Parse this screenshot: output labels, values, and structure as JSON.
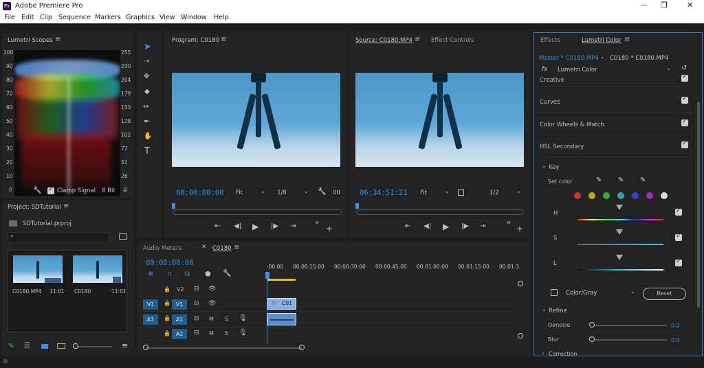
{
  "app": {
    "title": "Adobe Premiere Pro",
    "logo": "Pr"
  },
  "menu": [
    "File",
    "Edit",
    "Clip",
    "Sequence",
    "Markers",
    "Graphics",
    "View",
    "Window",
    "Help"
  ],
  "window_controls": {
    "minimize": "—",
    "maximize": "❐",
    "close": "✕"
  },
  "scopes": {
    "title": "Lumetri Scopes",
    "left_scale": [
      "100",
      "90",
      "80",
      "70",
      "60",
      "50",
      "40",
      "30",
      "20",
      "10",
      "0"
    ],
    "right_scale": [
      "255",
      "230",
      "204",
      "179",
      "153",
      "128",
      "102",
      "77",
      "51",
      "26",
      "0"
    ],
    "clamp_label": "Clamp Signal",
    "bit_depth": "8 Bit"
  },
  "project": {
    "title": "Project: SDTutorial",
    "file": "SDTutorial.prproj",
    "items": [
      {
        "name": "C0180.MP4",
        "duration": "11:01"
      },
      {
        "name": "C0180",
        "duration": "11:01"
      }
    ]
  },
  "program": {
    "title": "Program: C0180",
    "timecode": "00:00:00:00",
    "fit": "Fit",
    "resolution": "1/8",
    "end_time": "00"
  },
  "source": {
    "title": "Source: C0180.MP4",
    "tab2": "Effect Controls",
    "timecode": "06:34:51:21",
    "fit": "Fit",
    "resolution": "1/2"
  },
  "timeline": {
    "tab_audio": "Audio Meters",
    "tab_seq": "C0180",
    "timecode": "00:00:00:00",
    "ruler": [
      ":00:00",
      "00:00:15:00",
      "00:00:30:00",
      "00:00:45:00",
      "00:01:00:00",
      "00:01:15:00",
      "00:01:3"
    ],
    "tracks": [
      {
        "src": "",
        "name": "V2",
        "type": "video"
      },
      {
        "src": "V1",
        "name": "V1",
        "type": "video"
      },
      {
        "src": "A1",
        "name": "A1",
        "type": "audio"
      },
      {
        "src": "",
        "name": "A2",
        "type": "audio"
      }
    ],
    "clip_label": "C01",
    "clip_fx": "fx",
    "mute": "M",
    "solo": "S"
  },
  "lumetri": {
    "tab_effects": "Effects",
    "tab_lumetri": "Lumetri Color",
    "master": "Master * C0180.MP4",
    "clip": "C0180 * C0180.MP4",
    "fx": "fx",
    "effect_name": "Lumetri Color",
    "sections": [
      "Creative",
      "Curves",
      "Color Wheels & Match",
      "HSL Secondary"
    ],
    "key_label": "Key",
    "set_color": "Set color",
    "swatches": [
      "#c43a32",
      "#b5a829",
      "#3aa83a",
      "#2da2a2",
      "#3440d8",
      "#a02cb8",
      "#dcdcdc"
    ],
    "hsl_labels": [
      "H",
      "S",
      "L"
    ],
    "color_gray": "Color/Gray",
    "reset": "Reset",
    "refine": "Refine",
    "denoise": {
      "label": "Denoise",
      "value": "0.0"
    },
    "blur": {
      "label": "Blur",
      "value": "0.0"
    },
    "correction": "Correction"
  }
}
